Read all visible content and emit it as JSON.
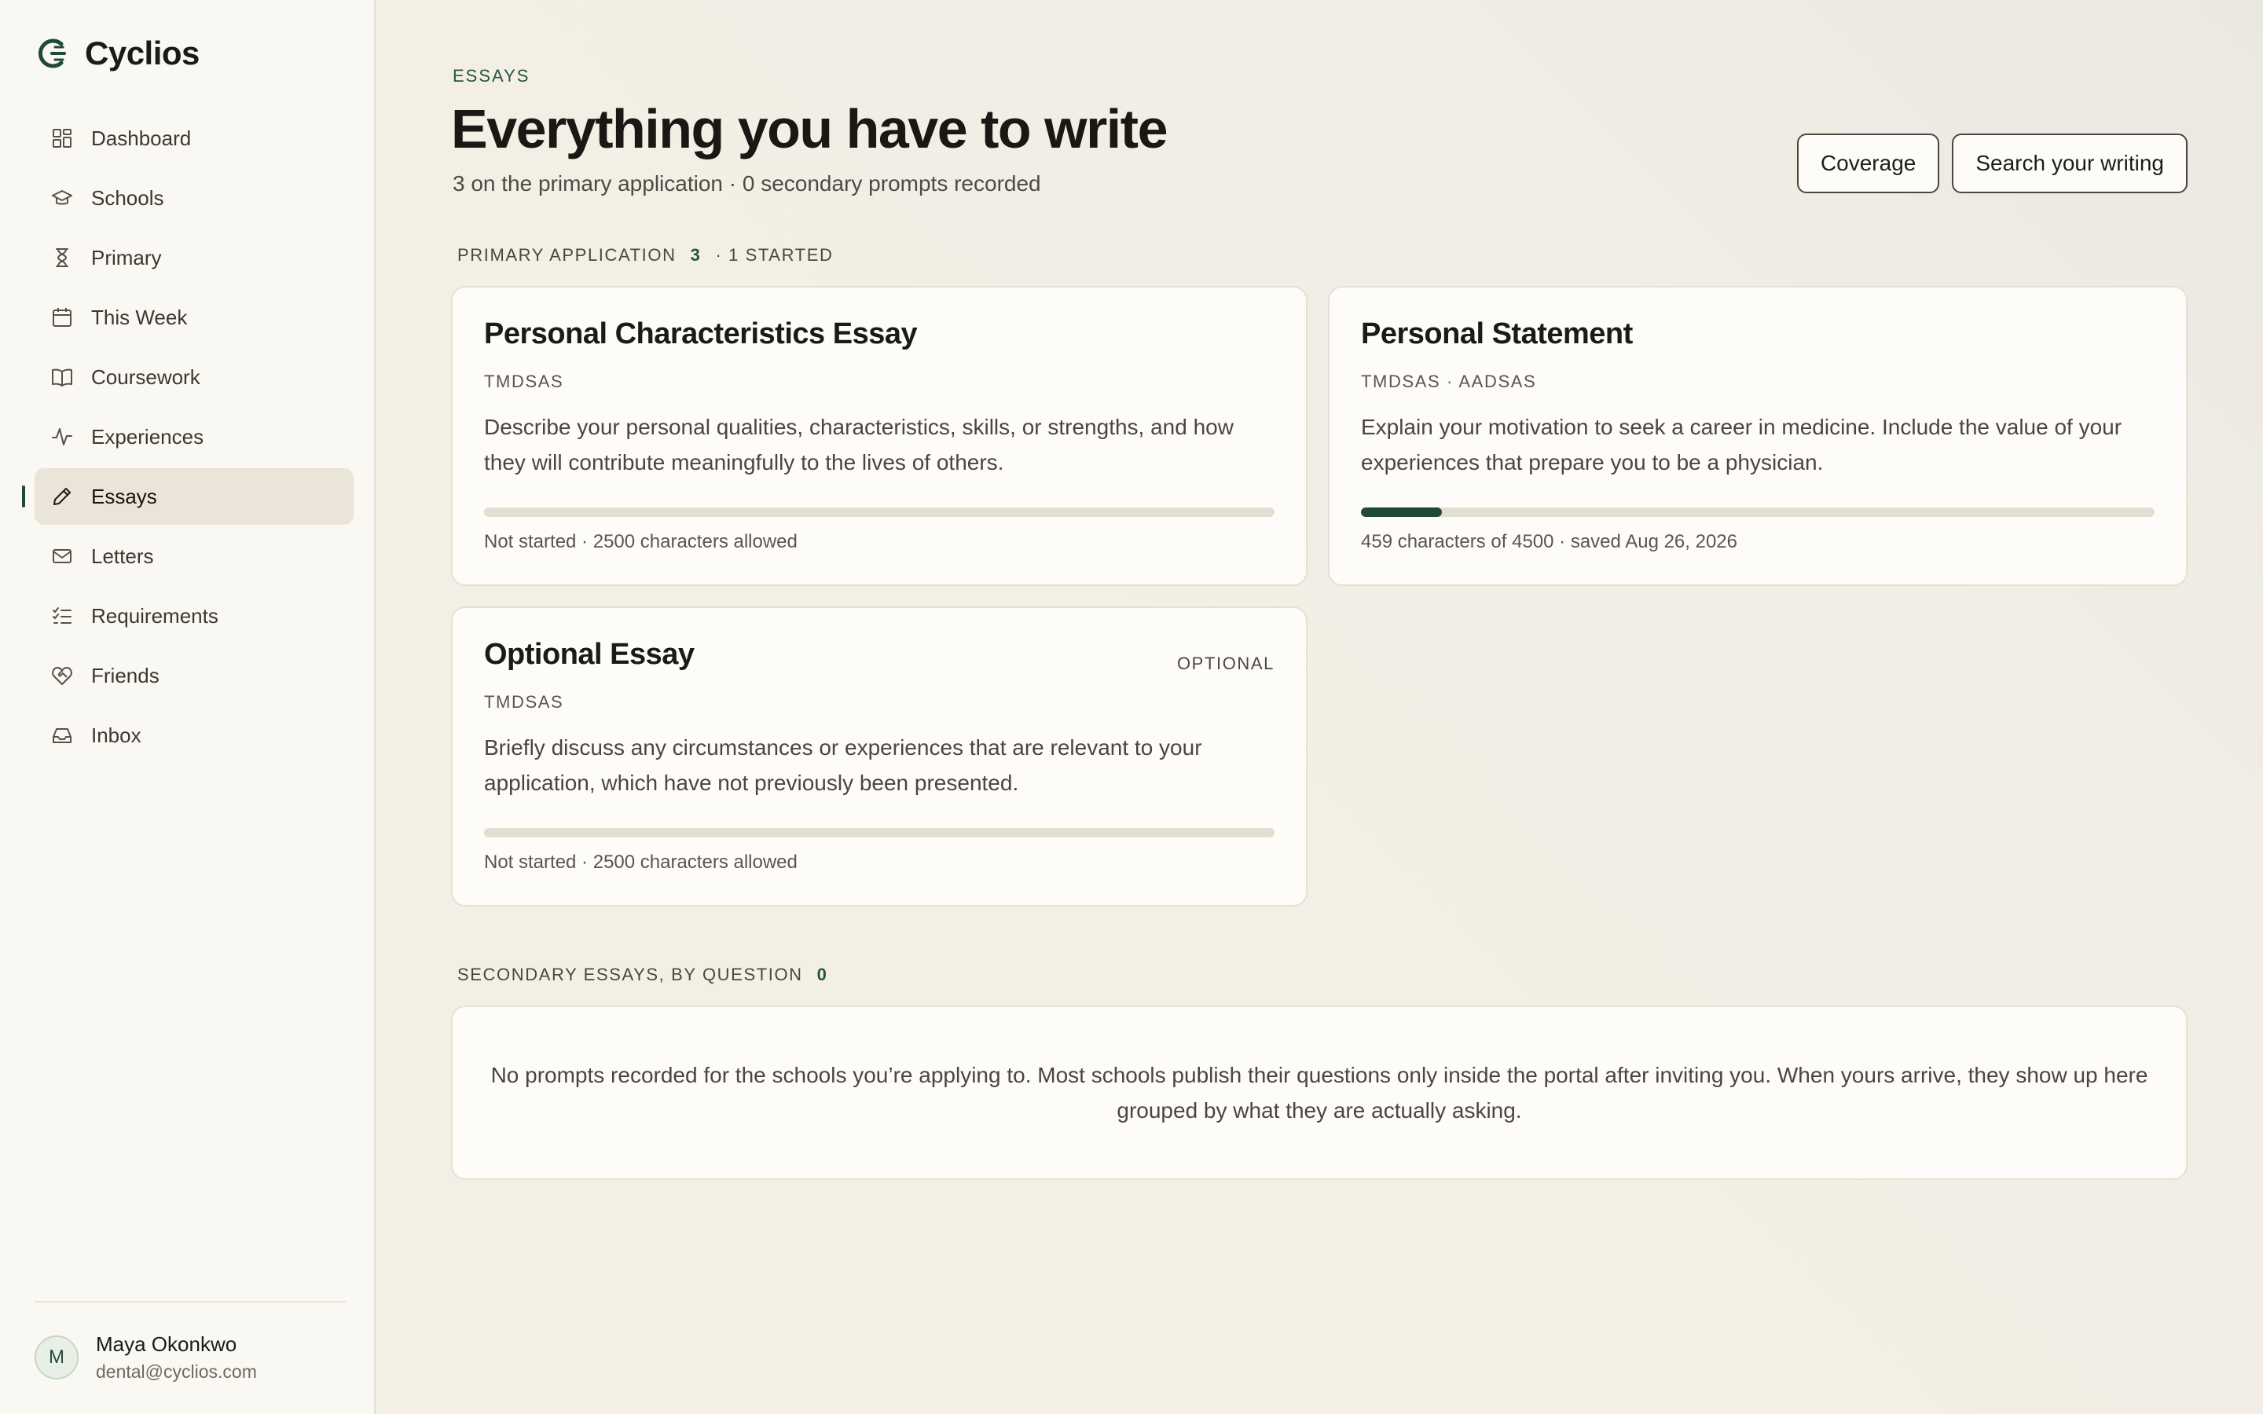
{
  "app": {
    "name": "Cyclios"
  },
  "sidebar": {
    "items": [
      {
        "label": "Dashboard",
        "icon": "dashboard-icon"
      },
      {
        "label": "Schools",
        "icon": "graduation-cap-icon"
      },
      {
        "label": "Primary",
        "icon": "hourglass-icon"
      },
      {
        "label": "This Week",
        "icon": "calendar-icon"
      },
      {
        "label": "Coursework",
        "icon": "book-icon"
      },
      {
        "label": "Experiences",
        "icon": "activity-icon"
      },
      {
        "label": "Essays",
        "icon": "pen-icon",
        "active": true
      },
      {
        "label": "Letters",
        "icon": "mail-icon"
      },
      {
        "label": "Requirements",
        "icon": "checklist-icon"
      },
      {
        "label": "Friends",
        "icon": "heart-handshake-icon"
      },
      {
        "label": "Inbox",
        "icon": "inbox-icon"
      }
    ],
    "user": {
      "initial": "M",
      "name": "Maya Okonkwo",
      "email": "dental@cyclios.com"
    }
  },
  "header": {
    "eyebrow": "ESSAYS",
    "title": "Everything you have to write",
    "subtitle": "3 on the primary application · 0 secondary prompts recorded",
    "buttons": {
      "coverage": "Coverage",
      "search": "Search your writing"
    }
  },
  "primary": {
    "heading": "PRIMARY APPLICATION",
    "count": "3",
    "started": "· 1 STARTED",
    "essays": [
      {
        "title": "Personal Characteristics Essay",
        "meta": "TMDSAS",
        "description": "Describe your personal qualities, characteristics, skills, or strengths, and how they will contribute meaningfully to the lives of others.",
        "progress": 0,
        "footer": "Not started · 2500 characters allowed"
      },
      {
        "title": "Personal Statement",
        "meta": "TMDSAS · AADSAS",
        "description": "Explain your motivation to seek a career in medicine. Include the value of your experiences that prepare you to be a physician.",
        "progress": 0.102,
        "footer": "459 characters of 4500 · saved Aug 26, 2026"
      },
      {
        "title": "Optional Essay",
        "tag": "OPTIONAL",
        "meta": "TMDSAS",
        "description": "Briefly discuss any circumstances or experiences that are relevant to your application, which have not previously been presented.",
        "progress": 0,
        "footer": "Not started · 2500 characters allowed"
      }
    ]
  },
  "secondary": {
    "heading": "SECONDARY ESSAYS, BY QUESTION",
    "count": "0",
    "empty_message": "No prompts recorded for the schools you’re applying to. Most schools publish their questions only inside the portal after inviting you. When yours arrive, they show up here grouped by what they are actually asking."
  },
  "colors": {
    "accent": "#1f4a35",
    "background": "#f3efe5",
    "card": "#fdfcf8"
  }
}
